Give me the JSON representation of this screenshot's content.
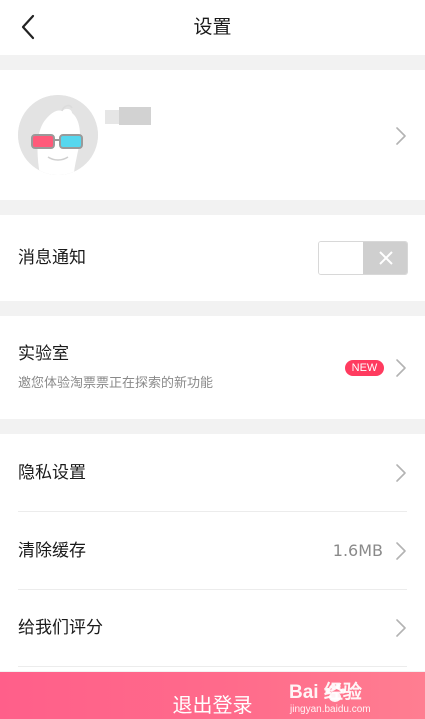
{
  "header": {
    "title": "设置",
    "back_icon": "chevron-left-icon"
  },
  "profile": {
    "avatar_icon": "avatar-3d-glasses",
    "username_blurred": true,
    "chevron_icon": "chevron-right-icon"
  },
  "notifications": {
    "label": "消息通知",
    "toggle_on": false,
    "toggle_icon": "close-icon"
  },
  "lab": {
    "title": "实验室",
    "subtitle": "邀您体验淘票票正在探索的新功能",
    "badge": "NEW",
    "badge_color": "#ff3b5f"
  },
  "settings_list": [
    {
      "label": "隐私设置",
      "value": ""
    },
    {
      "label": "清除缓存",
      "value": "1.6MB"
    },
    {
      "label": "给我们评分",
      "value": ""
    }
  ],
  "logout": {
    "label": "退出登录",
    "gradient": [
      "#ff5f8a",
      "#ff7e91"
    ]
  },
  "watermark": {
    "brand": "Bai  经验",
    "url": "jingyan.baidu.com"
  },
  "colors": {
    "accent": "#ff5f8a",
    "background": "#f2f2f2",
    "secondary_text": "#8a8a8a"
  }
}
